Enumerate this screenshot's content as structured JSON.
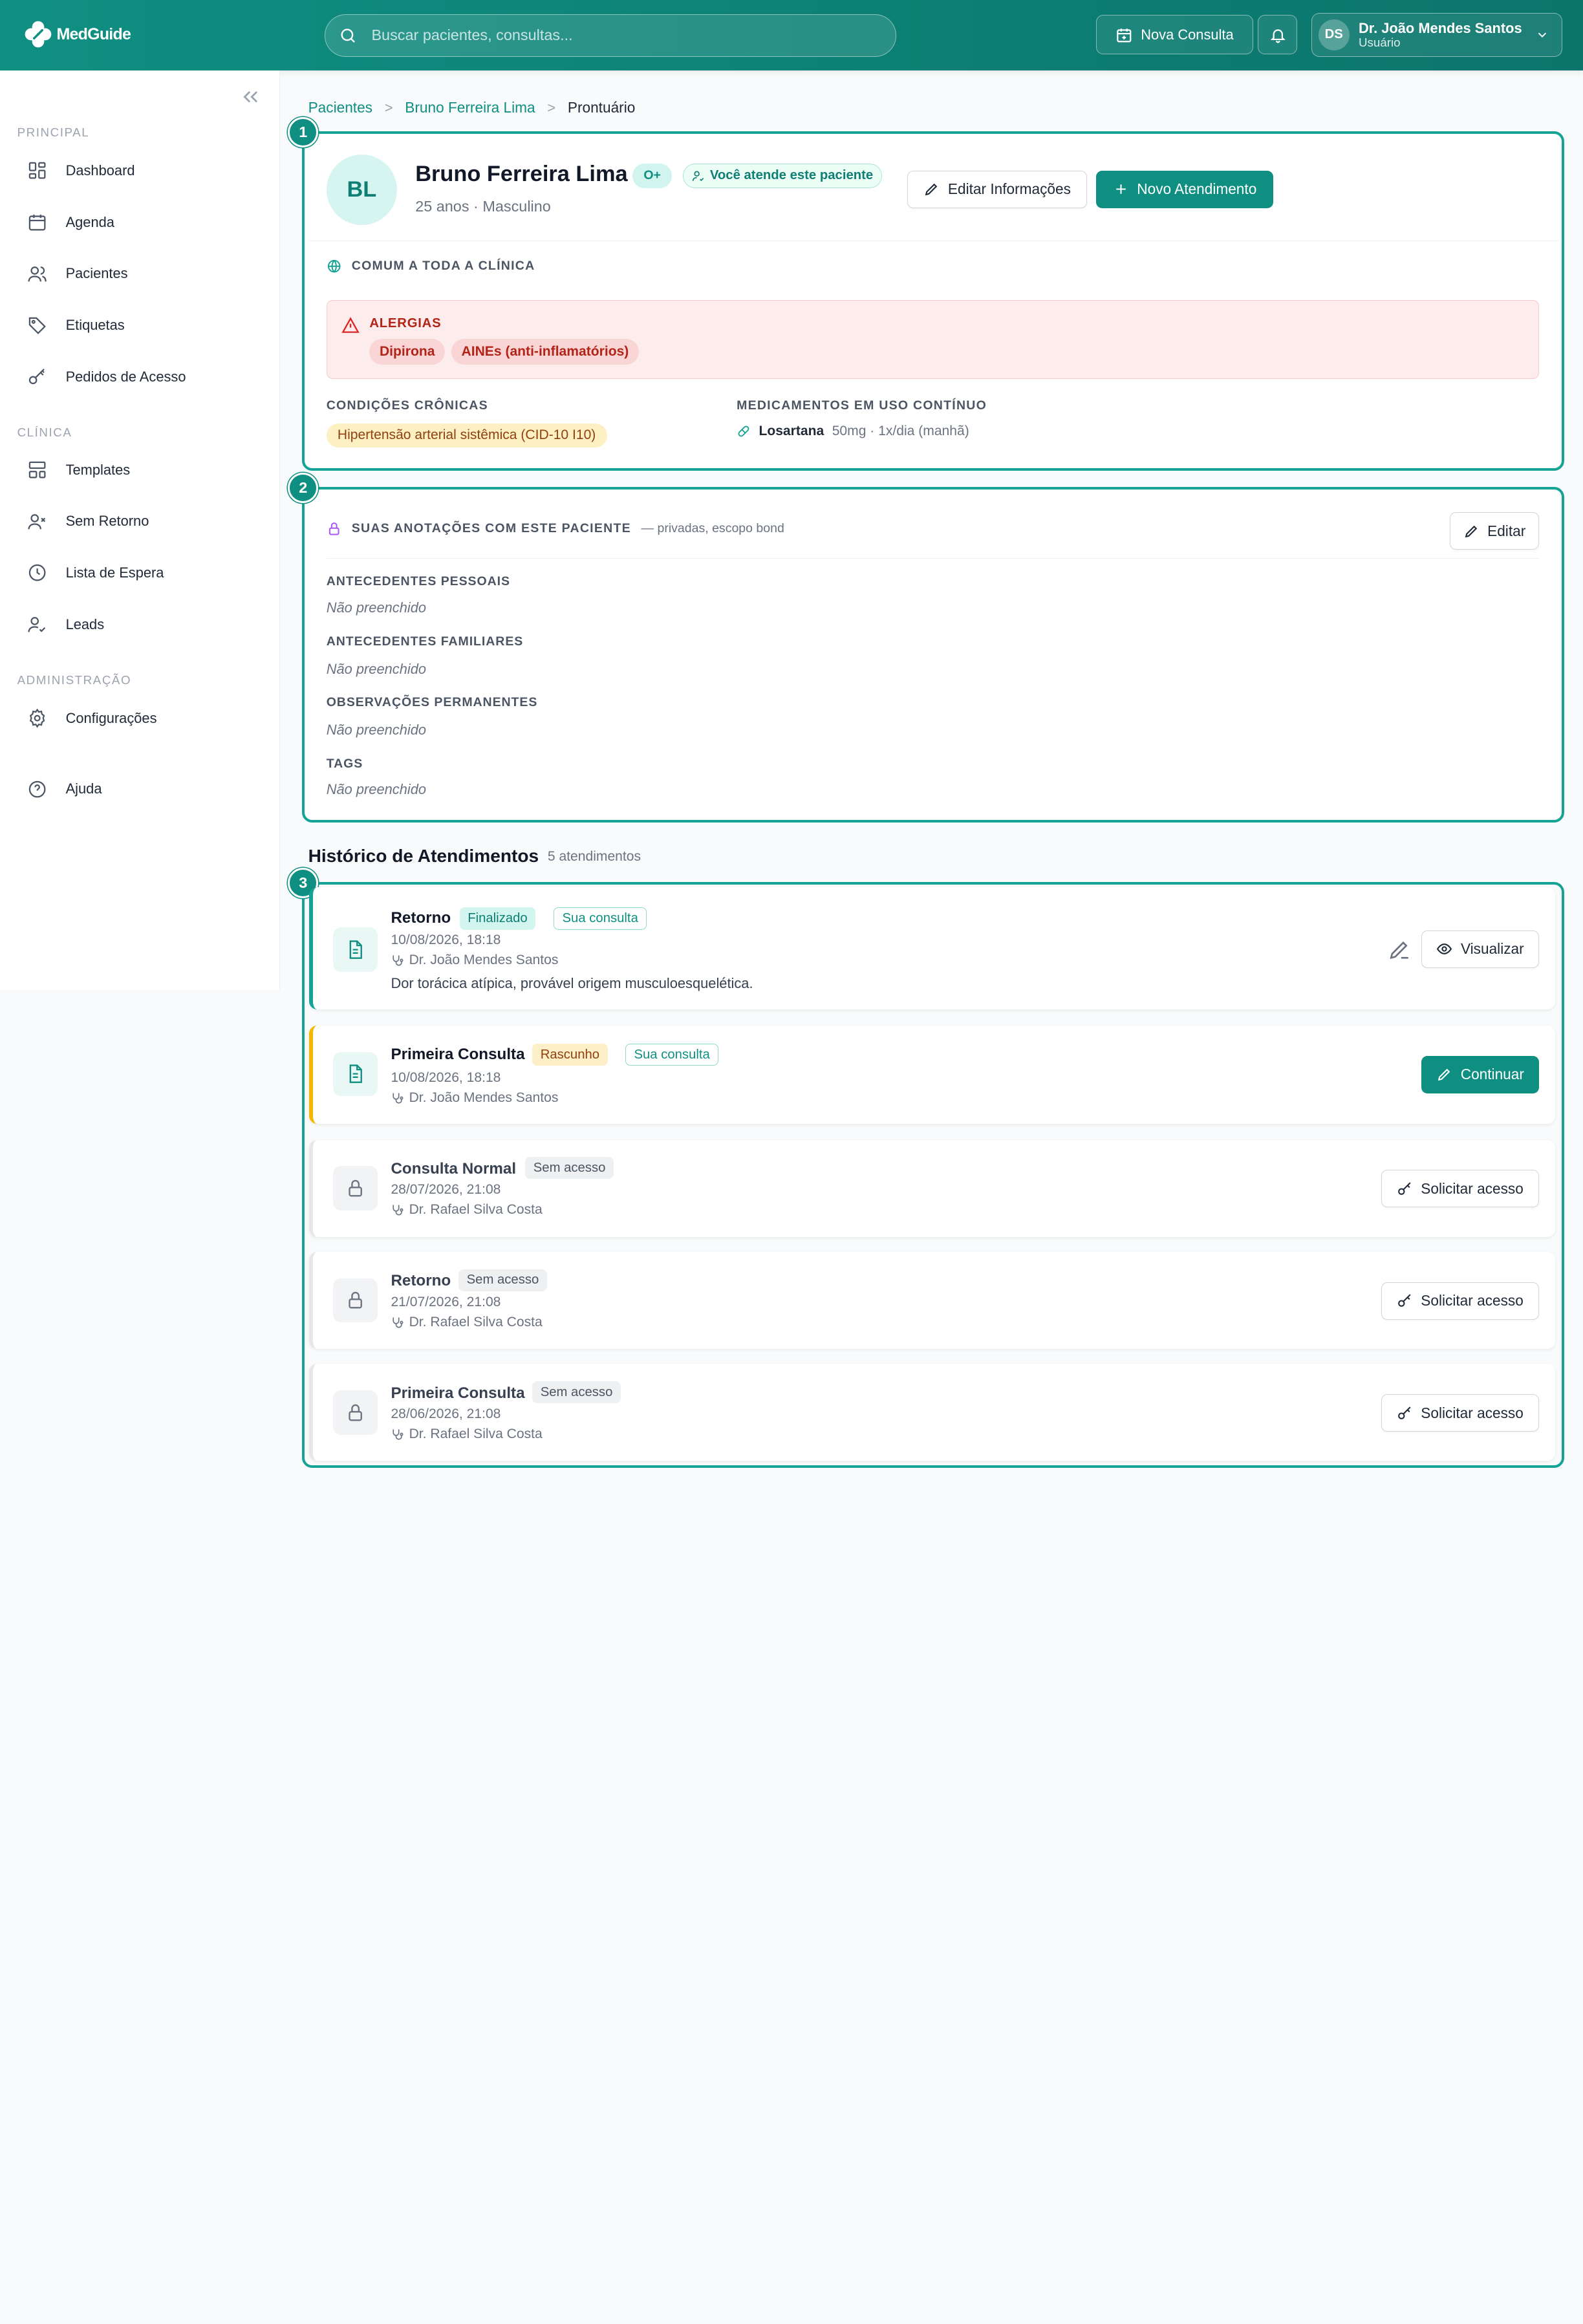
{
  "app": {
    "brand": "MedGuide",
    "search_placeholder": "Buscar pacientes, consultas...",
    "new_consult_label": "Nova Consulta",
    "user": {
      "initials": "DS",
      "name": "Dr. João Mendes Santos",
      "role": "Usuário"
    }
  },
  "sidebar": {
    "sections": [
      {
        "label": "PRINCIPAL"
      },
      {
        "label": "CLÍNICA"
      },
      {
        "label": "ADMINISTRAÇÃO"
      }
    ],
    "items": [
      {
        "label": "Dashboard",
        "icon": "dashboard-icon"
      },
      {
        "label": "Agenda",
        "icon": "calendar-icon"
      },
      {
        "label": "Pacientes",
        "icon": "users-icon"
      },
      {
        "label": "Etiquetas",
        "icon": "tag-icon"
      },
      {
        "label": "Pedidos de Acesso",
        "icon": "key-icon"
      },
      {
        "label": "Templates",
        "icon": "template-icon"
      },
      {
        "label": "Sem Retorno",
        "icon": "user-x-icon"
      },
      {
        "label": "Lista de Espera",
        "icon": "clock-icon"
      },
      {
        "label": "Leads",
        "icon": "user-check-icon"
      },
      {
        "label": "Configurações",
        "icon": "gear-icon"
      },
      {
        "label": "Ajuda",
        "icon": "help-icon"
      }
    ]
  },
  "breadcrumb": {
    "root": "Pacientes",
    "patient": "Bruno Ferreira Lima",
    "current": "Prontuário",
    "sep": ">"
  },
  "markers": [
    "1",
    "2",
    "3"
  ],
  "patient": {
    "initials": "BL",
    "name": "Bruno Ferreira Lima",
    "meta": "25 anos · Masculino",
    "blood_type": "O+",
    "attend_label": "Você atende este paciente",
    "edit_label": "Editar Informações",
    "new_visit_label": "Novo Atendimento",
    "common_label": "COMUM A TODA A CLÍNICA",
    "allergies_label": "ALERGIAS",
    "allergies": [
      "Dipirona",
      "AINEs (anti-inflamatórios)"
    ],
    "chronic_label": "CONDIÇÕES CRÔNICAS",
    "chronic": [
      "Hipertensão arterial sistêmica (CID-10 I10)"
    ],
    "meds_label": "MEDICAMENTOS EM USO CONTÍNUO",
    "meds": [
      {
        "name": "Losartana",
        "dose": "50mg · 1x/dia (manhã)"
      }
    ]
  },
  "notes": {
    "title": "SUAS ANOTAÇÕES COM ESTE PACIENTE",
    "subtitle": "— privadas, escopo bond",
    "edit_label": "Editar",
    "fields": [
      {
        "label": "ANTECEDENTES PESSOAIS",
        "value": "Não preenchido"
      },
      {
        "label": "ANTECEDENTES FAMILIARES",
        "value": "Não preenchido"
      },
      {
        "label": "OBSERVAÇÕES PERMANENTES",
        "value": "Não preenchido"
      },
      {
        "label": "TAGS",
        "value": "Não preenchido"
      }
    ]
  },
  "history": {
    "title": "Histórico de Atendimentos",
    "count": "5 atendimentos",
    "visits": [
      {
        "title": "Retorno",
        "status": "Finalizado",
        "own": "Sua consulta",
        "date": "10/08/2026, 18:18",
        "doctor": "Dr. João Mendes Santos",
        "description": "Dor torácica atípica, provável origem musculoesquelética.",
        "action": "Visualizar"
      },
      {
        "title": "Primeira Consulta",
        "status": "Rascunho",
        "own": "Sua consulta",
        "date": "10/08/2026, 18:18",
        "doctor": "Dr. João Mendes Santos",
        "action": "Continuar"
      },
      {
        "title": "Consulta Normal",
        "status": "Sem acesso",
        "date": "28/07/2026, 21:08",
        "doctor": "Dr. Rafael Silva Costa",
        "action": "Solicitar acesso"
      },
      {
        "title": "Retorno",
        "status": "Sem acesso",
        "date": "21/07/2026, 21:08",
        "doctor": "Dr. Rafael Silva Costa",
        "action": "Solicitar acesso"
      },
      {
        "title": "Primeira Consulta",
        "status": "Sem acesso",
        "date": "28/06/2026, 21:08",
        "doctor": "Dr. Rafael Silva Costa",
        "action": "Solicitar acesso"
      }
    ]
  },
  "colors": {
    "primary": "#0f8f82",
    "frame": "#14a394",
    "allergy_bg": "#fdecec",
    "draft": "#f5b700"
  }
}
